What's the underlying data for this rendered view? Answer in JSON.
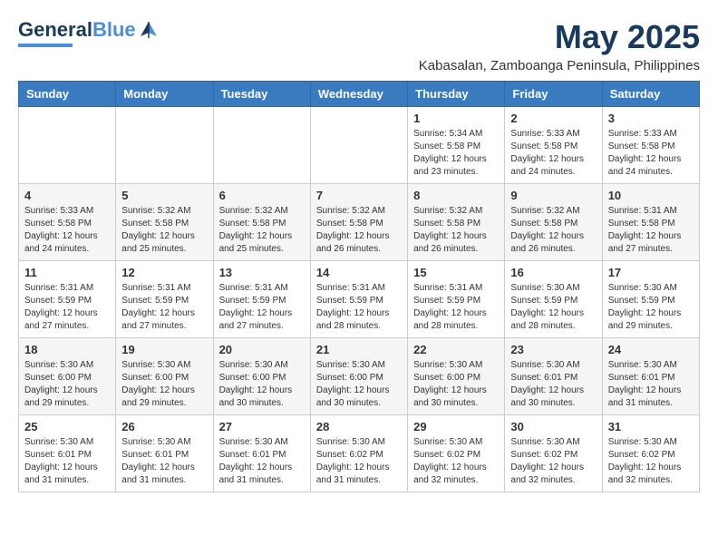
{
  "logo": {
    "text_general": "General",
    "text_blue": "Blue"
  },
  "title": "May 2025",
  "subtitle": "Kabasalan, Zamboanga Peninsula, Philippines",
  "days_of_week": [
    "Sunday",
    "Monday",
    "Tuesday",
    "Wednesday",
    "Thursday",
    "Friday",
    "Saturday"
  ],
  "weeks": [
    [
      {
        "day": "",
        "info": ""
      },
      {
        "day": "",
        "info": ""
      },
      {
        "day": "",
        "info": ""
      },
      {
        "day": "",
        "info": ""
      },
      {
        "day": "1",
        "info": "Sunrise: 5:34 AM\nSunset: 5:58 PM\nDaylight: 12 hours\nand 23 minutes."
      },
      {
        "day": "2",
        "info": "Sunrise: 5:33 AM\nSunset: 5:58 PM\nDaylight: 12 hours\nand 24 minutes."
      },
      {
        "day": "3",
        "info": "Sunrise: 5:33 AM\nSunset: 5:58 PM\nDaylight: 12 hours\nand 24 minutes."
      }
    ],
    [
      {
        "day": "4",
        "info": "Sunrise: 5:33 AM\nSunset: 5:58 PM\nDaylight: 12 hours\nand 24 minutes."
      },
      {
        "day": "5",
        "info": "Sunrise: 5:32 AM\nSunset: 5:58 PM\nDaylight: 12 hours\nand 25 minutes."
      },
      {
        "day": "6",
        "info": "Sunrise: 5:32 AM\nSunset: 5:58 PM\nDaylight: 12 hours\nand 25 minutes."
      },
      {
        "day": "7",
        "info": "Sunrise: 5:32 AM\nSunset: 5:58 PM\nDaylight: 12 hours\nand 26 minutes."
      },
      {
        "day": "8",
        "info": "Sunrise: 5:32 AM\nSunset: 5:58 PM\nDaylight: 12 hours\nand 26 minutes."
      },
      {
        "day": "9",
        "info": "Sunrise: 5:32 AM\nSunset: 5:58 PM\nDaylight: 12 hours\nand 26 minutes."
      },
      {
        "day": "10",
        "info": "Sunrise: 5:31 AM\nSunset: 5:58 PM\nDaylight: 12 hours\nand 27 minutes."
      }
    ],
    [
      {
        "day": "11",
        "info": "Sunrise: 5:31 AM\nSunset: 5:59 PM\nDaylight: 12 hours\nand 27 minutes."
      },
      {
        "day": "12",
        "info": "Sunrise: 5:31 AM\nSunset: 5:59 PM\nDaylight: 12 hours\nand 27 minutes."
      },
      {
        "day": "13",
        "info": "Sunrise: 5:31 AM\nSunset: 5:59 PM\nDaylight: 12 hours\nand 27 minutes."
      },
      {
        "day": "14",
        "info": "Sunrise: 5:31 AM\nSunset: 5:59 PM\nDaylight: 12 hours\nand 28 minutes."
      },
      {
        "day": "15",
        "info": "Sunrise: 5:31 AM\nSunset: 5:59 PM\nDaylight: 12 hours\nand 28 minutes."
      },
      {
        "day": "16",
        "info": "Sunrise: 5:30 AM\nSunset: 5:59 PM\nDaylight: 12 hours\nand 28 minutes."
      },
      {
        "day": "17",
        "info": "Sunrise: 5:30 AM\nSunset: 5:59 PM\nDaylight: 12 hours\nand 29 minutes."
      }
    ],
    [
      {
        "day": "18",
        "info": "Sunrise: 5:30 AM\nSunset: 6:00 PM\nDaylight: 12 hours\nand 29 minutes."
      },
      {
        "day": "19",
        "info": "Sunrise: 5:30 AM\nSunset: 6:00 PM\nDaylight: 12 hours\nand 29 minutes."
      },
      {
        "day": "20",
        "info": "Sunrise: 5:30 AM\nSunset: 6:00 PM\nDaylight: 12 hours\nand 30 minutes."
      },
      {
        "day": "21",
        "info": "Sunrise: 5:30 AM\nSunset: 6:00 PM\nDaylight: 12 hours\nand 30 minutes."
      },
      {
        "day": "22",
        "info": "Sunrise: 5:30 AM\nSunset: 6:00 PM\nDaylight: 12 hours\nand 30 minutes."
      },
      {
        "day": "23",
        "info": "Sunrise: 5:30 AM\nSunset: 6:01 PM\nDaylight: 12 hours\nand 30 minutes."
      },
      {
        "day": "24",
        "info": "Sunrise: 5:30 AM\nSunset: 6:01 PM\nDaylight: 12 hours\nand 31 minutes."
      }
    ],
    [
      {
        "day": "25",
        "info": "Sunrise: 5:30 AM\nSunset: 6:01 PM\nDaylight: 12 hours\nand 31 minutes."
      },
      {
        "day": "26",
        "info": "Sunrise: 5:30 AM\nSunset: 6:01 PM\nDaylight: 12 hours\nand 31 minutes."
      },
      {
        "day": "27",
        "info": "Sunrise: 5:30 AM\nSunset: 6:01 PM\nDaylight: 12 hours\nand 31 minutes."
      },
      {
        "day": "28",
        "info": "Sunrise: 5:30 AM\nSunset: 6:02 PM\nDaylight: 12 hours\nand 31 minutes."
      },
      {
        "day": "29",
        "info": "Sunrise: 5:30 AM\nSunset: 6:02 PM\nDaylight: 12 hours\nand 32 minutes."
      },
      {
        "day": "30",
        "info": "Sunrise: 5:30 AM\nSunset: 6:02 PM\nDaylight: 12 hours\nand 32 minutes."
      },
      {
        "day": "31",
        "info": "Sunrise: 5:30 AM\nSunset: 6:02 PM\nDaylight: 12 hours\nand 32 minutes."
      }
    ]
  ]
}
